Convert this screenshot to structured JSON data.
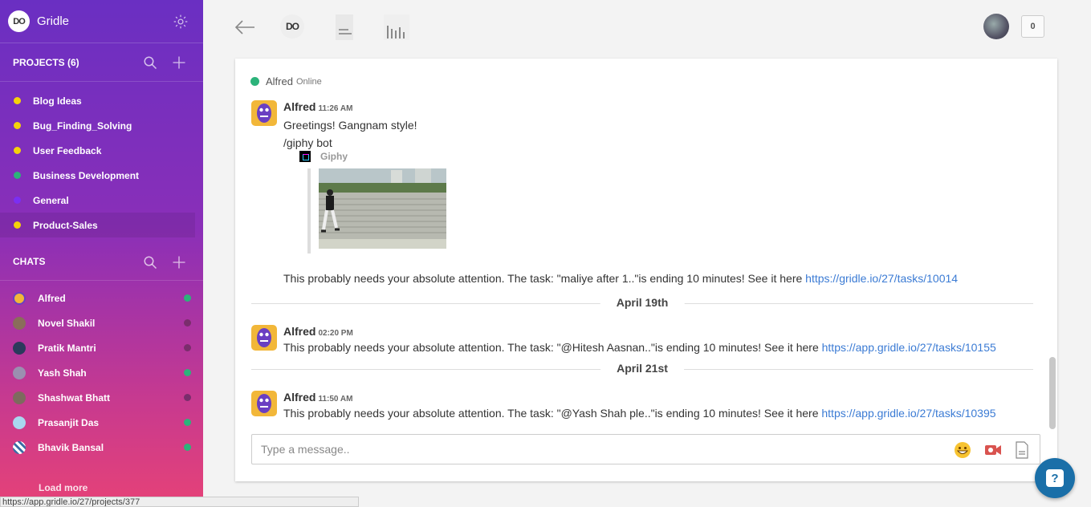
{
  "app": {
    "brand": "Gridle",
    "logo_text": "DO"
  },
  "projects": {
    "heading": "PROJECTS (6)",
    "items": [
      {
        "label": "Blog Ideas",
        "color": "#f5d20a"
      },
      {
        "label": "Bug_Finding_Solving",
        "color": "#f5d20a"
      },
      {
        "label": "User Feedback",
        "color": "#f5d20a"
      },
      {
        "label": "Business Development",
        "color": "#2cb37a"
      },
      {
        "label": "General",
        "color": "#7b2ff2"
      },
      {
        "label": "Product-Sales",
        "color": "#f5d20a"
      }
    ]
  },
  "chats": {
    "heading": "CHATS",
    "items": [
      {
        "label": "Alfred",
        "status": "#2cb37a"
      },
      {
        "label": "Novel Shakil",
        "status": "#7a2d6c"
      },
      {
        "label": "Pratik Mantri",
        "status": "#7a2d6c"
      },
      {
        "label": "Yash Shah",
        "status": "#2cb37a"
      },
      {
        "label": "Shashwat Bhatt",
        "status": "#7a2d6c"
      },
      {
        "label": "Prasanjit Das",
        "status": "#2cb37a"
      },
      {
        "label": "Bhavik Bansal",
        "status": "#2cb37a"
      }
    ],
    "load_more": "Load more"
  },
  "status_url": "https://app.gridle.io/27/projects/377",
  "topbar": {
    "notification_count": "0"
  },
  "conversation": {
    "contact": "Alfred",
    "contact_status": "Online",
    "messages": [
      {
        "author": "Alfred",
        "time": "11:26 AM",
        "lines": [
          "Greetings! Gangnam style!",
          "/giphy bot"
        ]
      },
      {
        "author": "Alfred",
        "time": "02:20 PM",
        "text": "This probably needs your absolute attention. The task: \"@Hitesh Aasnan..\"is ending 10 minutes! See it here ",
        "link": "https://app.gridle.io/27/tasks/10155"
      },
      {
        "author": "Alfred",
        "time": "11:50 AM",
        "text": "This probably needs your absolute attention. The task: \"@Yash Shah ple..\"is ending 10 minutes! See it here ",
        "link": "https://app.gridle.io/27/tasks/10395"
      }
    ],
    "giphy": {
      "label": "Giphy"
    },
    "standalone": {
      "text": "This probably needs your absolute attention. The task: \"maliye after 1..\"is ending 10 minutes! See it here ",
      "link": "https://gridle.io/27/tasks/10014"
    },
    "dates": [
      "April 19th",
      "April 21st"
    ],
    "input_placeholder": "Type a message.."
  },
  "help": {
    "label": "?"
  }
}
